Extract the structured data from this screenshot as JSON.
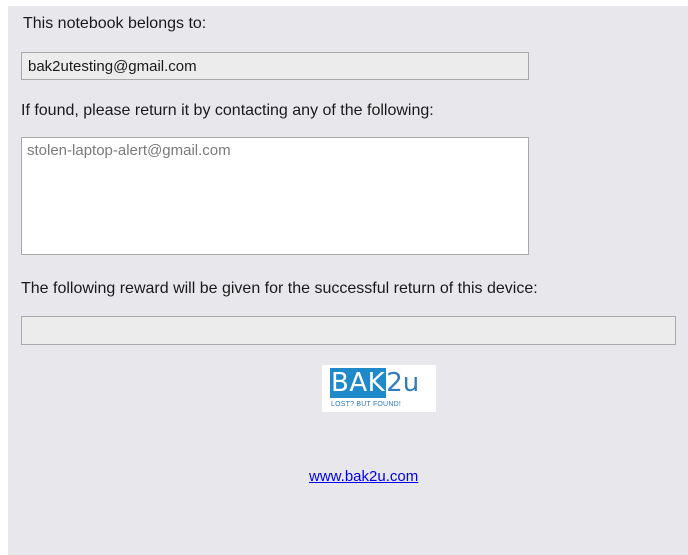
{
  "owner": {
    "label": "This notebook belongs to:",
    "value": "bak2utesting@gmail.com"
  },
  "contacts": {
    "label": "If found, please return it by contacting any of the following:",
    "value": "stolen-laptop-alert@gmail.com"
  },
  "reward": {
    "label": "The following reward will be given for the successful return of this device:",
    "value": ""
  },
  "logo": {
    "brand_part1": "BAK",
    "brand_part2": "2u",
    "tagline": "LOST? BUT FOUND!"
  },
  "footer": {
    "link_text": "www.bak2u.com"
  },
  "colors": {
    "panel_background": "#e8e8ec",
    "logo_blue": "#2089c9",
    "link": "#0000ee"
  }
}
